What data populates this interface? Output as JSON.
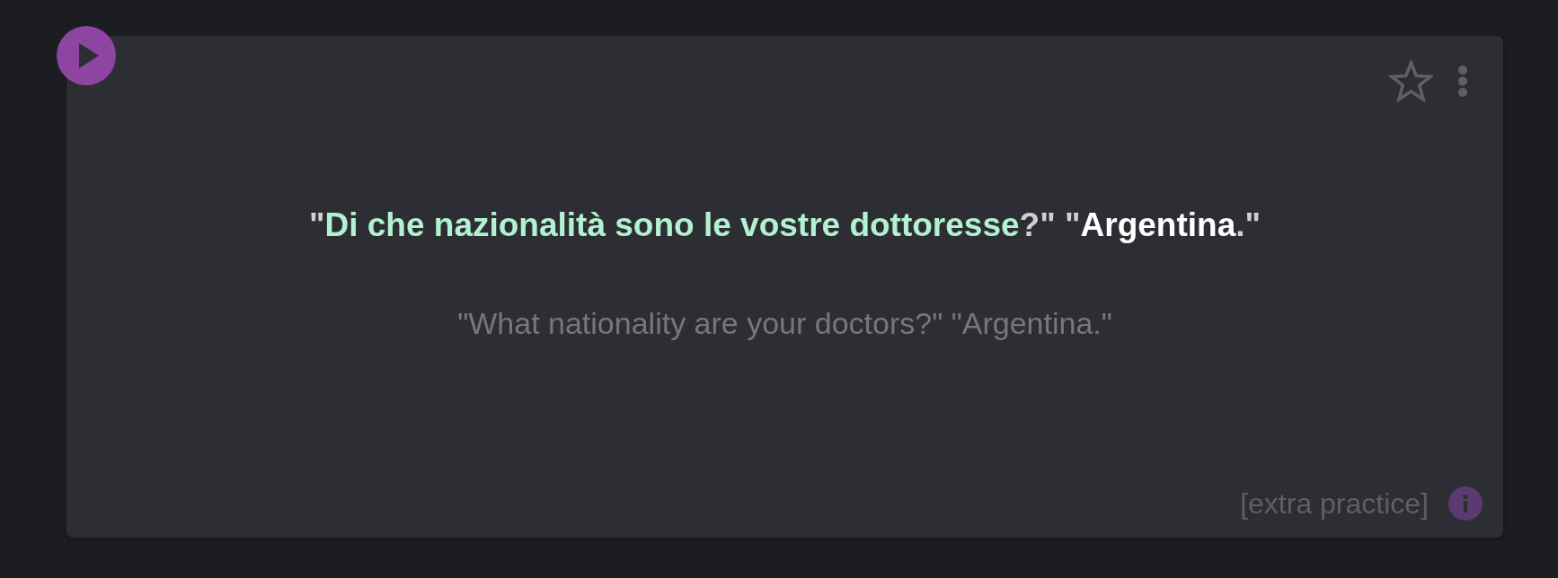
{
  "card": {
    "starred": false,
    "sentence": [
      {
        "text": "\"",
        "kind": "punct"
      },
      {
        "text": "Di che nazionalità sono le vostre dottoresse",
        "kind": "target"
      },
      {
        "text": "?\" \"",
        "kind": "punct"
      },
      {
        "text": "Argentina",
        "kind": "answer"
      },
      {
        "text": ".\"",
        "kind": "punct"
      }
    ],
    "translation": "\"What nationality are your doctors?\" \"Argentina.\"",
    "tag": "[extra practice]"
  }
}
